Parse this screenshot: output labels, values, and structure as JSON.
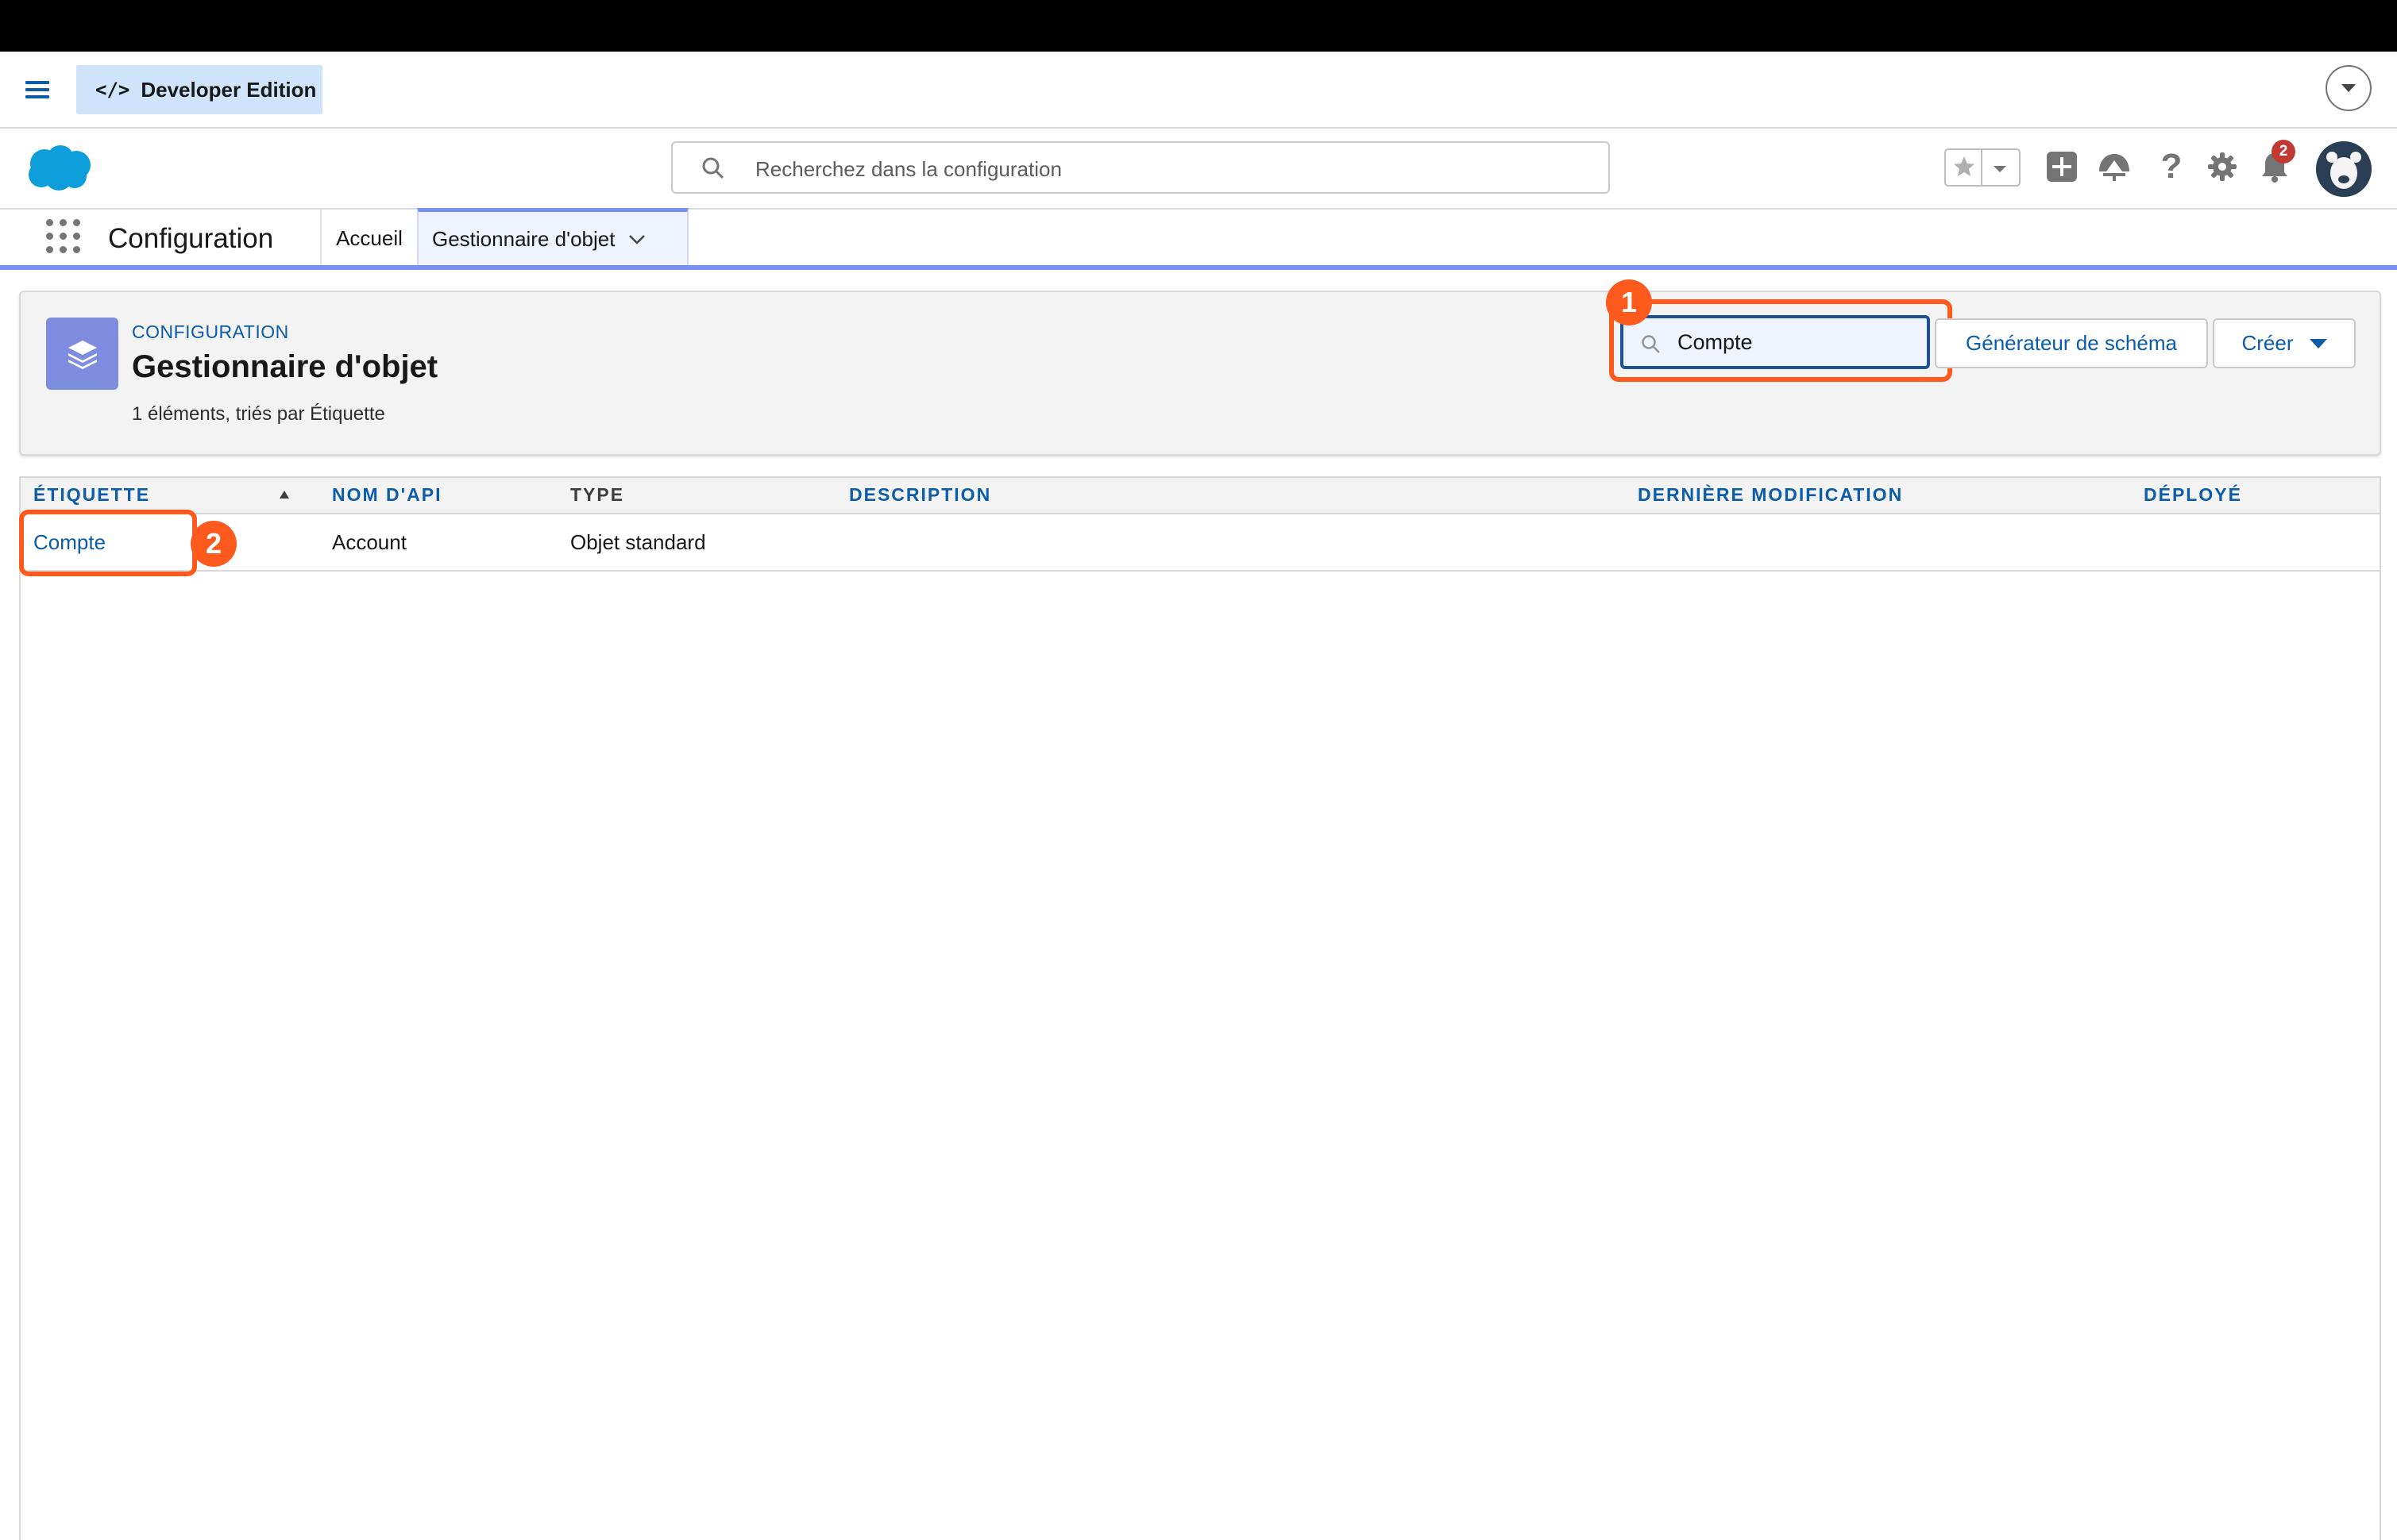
{
  "top_bar": {
    "edition_label": "Developer Edition",
    "edition_icon": "code-icon",
    "code_glyph": "</>"
  },
  "global_header": {
    "search_placeholder": "Recherchez dans la configuration",
    "notification_count": "2"
  },
  "nav": {
    "app_name": "Configuration",
    "tabs": [
      {
        "label": "Accueil",
        "active": false
      },
      {
        "label": "Gestionnaire d'objet",
        "active": true
      }
    ]
  },
  "page_header": {
    "eyebrow": "CONFIGURATION",
    "title": "Gestionnaire d'objet",
    "subtitle": "1 éléments, triés par Étiquette",
    "quick_find_value": "Compte",
    "schema_button": "Générateur de schéma",
    "create_button": "Créer",
    "callout_1": "1"
  },
  "table": {
    "columns": [
      "ÉTIQUETTE",
      "NOM D'API",
      "TYPE",
      "DESCRIPTION",
      "DERNIÈRE MODIFICATION",
      "DÉPLOYÉ"
    ],
    "rows": [
      {
        "label": "Compte",
        "api_name": "Account",
        "type": "Objet standard",
        "description": "",
        "last_modified": "",
        "deployed": ""
      }
    ],
    "callout_2": "2"
  },
  "colors": {
    "brand_blue": "#0b5cab",
    "callout_orange": "#fe5a1d",
    "nav_accent": "#7a8ff0",
    "object_icon_bg": "#7f8de1",
    "notification_red": "#c23934"
  }
}
